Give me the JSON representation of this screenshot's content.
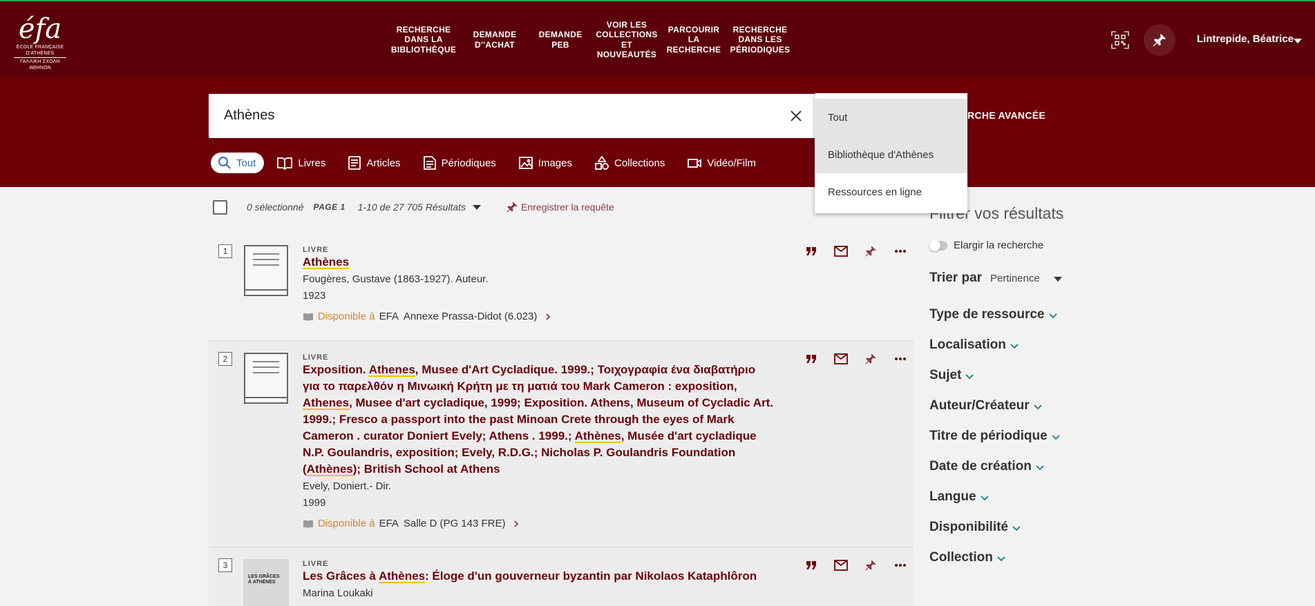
{
  "logo": {
    "mark": "éfa",
    "line1": "ÉCOLE FRANÇAISE D'ATHÈNES",
    "line2": "ΓΑΛΛΙΚΗ ΣΧΟΛΗ ΑΘΗΝΩΝ"
  },
  "nav": [
    {
      "label": "RECHERCHE DANS LA BIBLIOTHÈQUE",
      "lines": [
        "RECHERCHE",
        "DANS LA",
        "BIBLIOTHÈQUE"
      ]
    },
    {
      "label": "DEMANDE D''ACHAT",
      "lines": [
        "DEMANDE",
        "D''ACHAT"
      ]
    },
    {
      "label": "DEMANDE PEB",
      "lines": [
        "DEMANDE",
        "PEB"
      ]
    },
    {
      "label": "VOIR LES COLLECTIONS ET NOUVEAUTÉS",
      "lines": [
        "VOIR LES",
        "COLLECTIONS",
        "ET",
        "NOUVEAUTÉS"
      ]
    },
    {
      "label": "PARCOURIR LA RECHERCHE",
      "lines": [
        "PARCOURIR",
        "LA",
        "RECHERCHE"
      ]
    },
    {
      "label": "RECHERCHE DANS LES PÉRIODIQUES",
      "lines": [
        "RECHERCHE",
        "DANS LES",
        "PÉRIODIQUES"
      ]
    }
  ],
  "user": {
    "name": "Lintrepide, Béatrice"
  },
  "search": {
    "value": "Athènes",
    "advanced_label": "RCHE AVANCÉE"
  },
  "tabs": [
    {
      "label": "Tout",
      "icon": "search-icon",
      "active": true
    },
    {
      "label": "Livres",
      "icon": "book-icon"
    },
    {
      "label": "Articles",
      "icon": "article-icon"
    },
    {
      "label": "Périodiques",
      "icon": "periodical-icon"
    },
    {
      "label": "Images",
      "icon": "image-icon"
    },
    {
      "label": "Collections",
      "icon": "shapes-icon"
    },
    {
      "label": "Vidéo/Film",
      "icon": "video-icon"
    }
  ],
  "scope_dropdown": {
    "options": [
      "Tout",
      "Bibliothèque d'Athènes",
      "Ressources en ligne"
    ],
    "highlighted": [
      "Tout",
      "Bibliothèque d'Athènes"
    ]
  },
  "results_header": {
    "selected": "0 sélectionné",
    "page": "PAGE 1",
    "count": "1-10 de 27 705 Résultats",
    "save_query": "Enregistrer la requête"
  },
  "results": [
    {
      "number": "1",
      "type": "LIVRE",
      "title_parts": [
        {
          "text": "Athènes",
          "hl": true
        }
      ],
      "author": "Fougères, Gustave (1863-1927). Auteur.",
      "year": "1923",
      "availability": {
        "status": "Disponible à",
        "library": "EFA",
        "location": "Annexe Prassa-Didot (6.023)"
      }
    },
    {
      "number": "2",
      "type": "LIVRE",
      "title_lines": [
        [
          {
            "text": "Exposition. "
          },
          {
            "text": "Athenes",
            "hl": true
          },
          {
            "text": ", Musee d'Art Cycladique. 1999.; Τοιχογραφία ένα διαβατήριο"
          }
        ],
        [
          {
            "text": "για το παρελθόν η Μινωική Κρήτη με τη ματιά του Mark Cameron : exposition,"
          }
        ],
        [
          {
            "text": "Athenes",
            "hl": true
          },
          {
            "text": ", Musee d'art cycladique, 1999; Exposition. Athens, Museum of Cycladic Art."
          }
        ],
        [
          {
            "text": "1999.; Fresco a passport into the past Minoan Crete through the eyes of Mark"
          }
        ],
        [
          {
            "text": "Cameron . curator Doniert Evely; Athens . 1999.; "
          },
          {
            "text": "Athènes",
            "hl": true
          },
          {
            "text": ", Musée d'art cycladique"
          }
        ],
        [
          {
            "text": "N.P. Goulandris, exposition; Evely, R.D.G.; Nicholas P. Goulandris Foundation"
          }
        ],
        [
          {
            "text": "("
          },
          {
            "text": "Athènes",
            "hl": true
          },
          {
            "text": "); British School at Athens"
          }
        ]
      ],
      "author": "Evely, Doniert.- Dir.",
      "year": "1999",
      "availability": {
        "status": "Disponible à",
        "library": "EFA",
        "location": "Salle D (PG 143 FRE)"
      }
    },
    {
      "number": "3",
      "type": "LIVRE",
      "title_parts": [
        {
          "text": "Les Grâces à "
        },
        {
          "text": "Athènes",
          "hl": true
        },
        {
          "text": ": Éloge d'un gouverneur byzantin par Nikolaos Kataphlôron"
        }
      ],
      "author": "Marina Loukaki",
      "cover_text": "LES GRÂCES À ATHÈNES"
    }
  ],
  "filters": {
    "title": "Filtrer vos résultats",
    "expand_label": "Elargir la recherche",
    "sort_label": "Trier par",
    "sort_value": "Pertinence",
    "facets": [
      "Type de ressource",
      "Localisation",
      "Sujet",
      "Auteur/Créateur",
      "Titre de périodique",
      "Date de création",
      "Langue",
      "Disponibilité",
      "Collection"
    ]
  },
  "colors": {
    "header": "#5b0008",
    "search_band": "#6e0008",
    "title": "#6e0008",
    "available": "#d9822b",
    "highlight": "#f0c000"
  }
}
